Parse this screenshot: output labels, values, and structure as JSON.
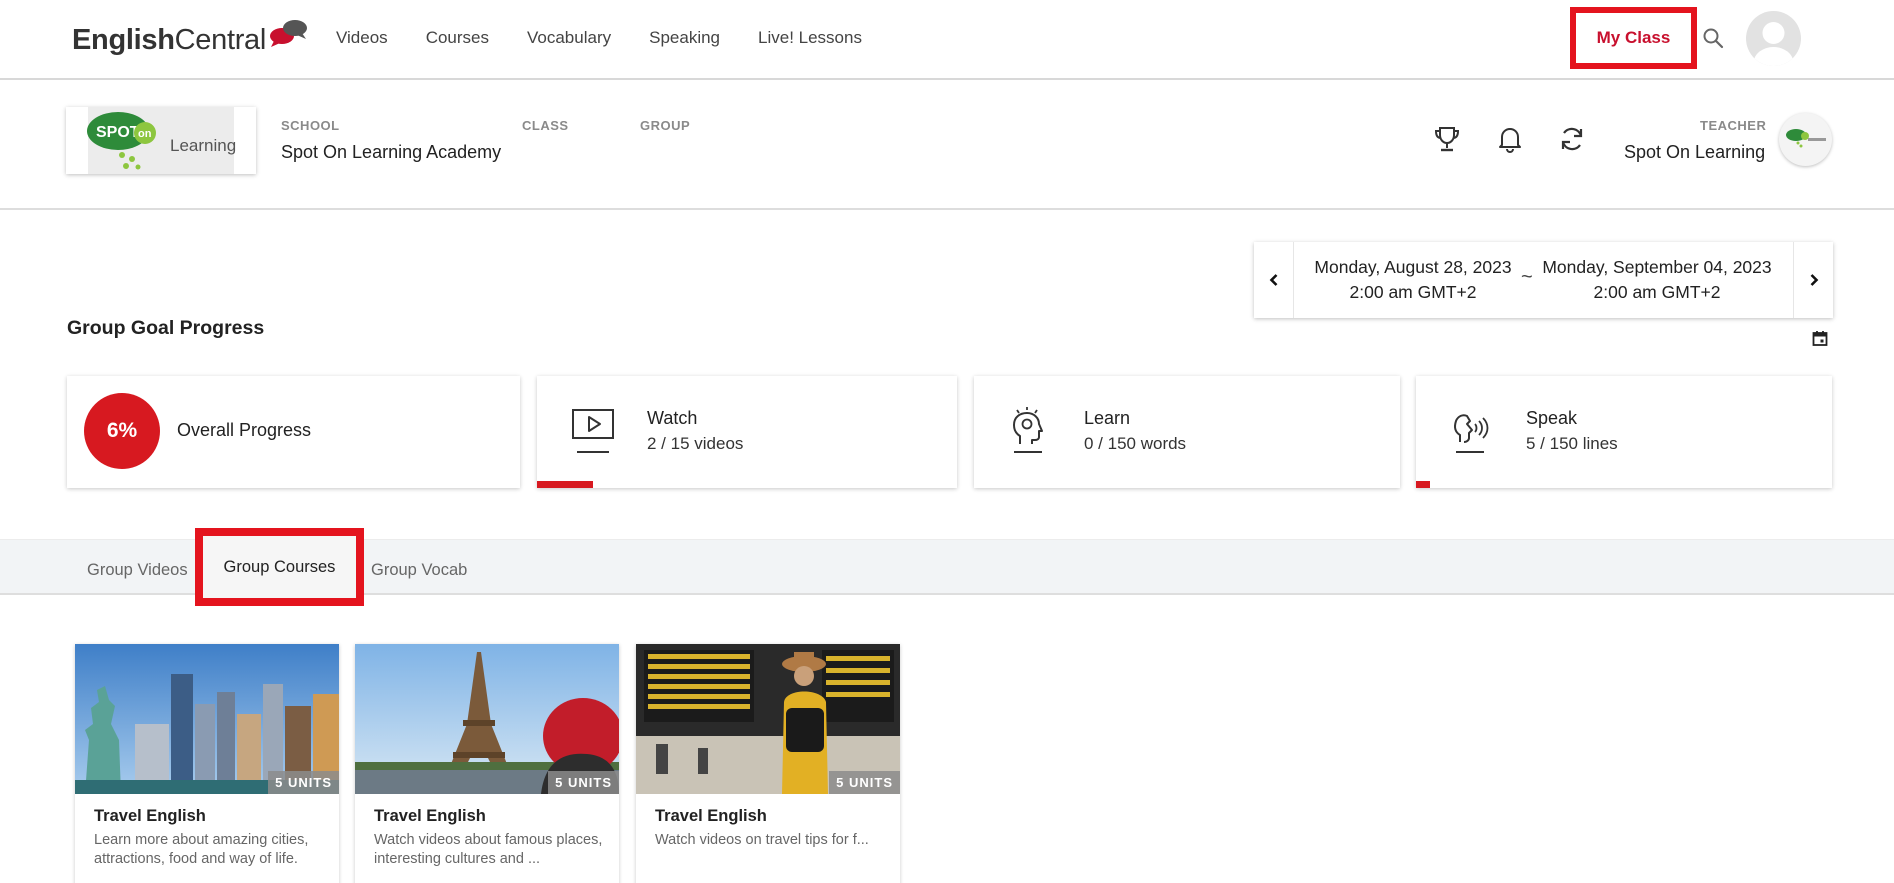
{
  "nav": {
    "logo_bold": "English",
    "logo_light": "Central",
    "links": [
      "Videos",
      "Courses",
      "Vocabulary",
      "Speaking",
      "Live! Lessons"
    ],
    "my_class": "My Class"
  },
  "class_bar": {
    "school_label": "SCHOOL",
    "school_value": "Spot On Learning Academy",
    "class_label": "CLASS",
    "group_label": "GROUP",
    "teacher_label": "TEACHER",
    "teacher_value": "Spot On Learning",
    "logo_spot": "SPOT",
    "logo_on": "on",
    "logo_learning": "Learning"
  },
  "date_range": {
    "start_date": "Monday, August 28, 2023",
    "start_time": "2:00 am GMT+2",
    "separator": "~",
    "end_date": "Monday, September 04, 2023",
    "end_time": "2:00 am GMT+2"
  },
  "goal": {
    "title": "Group Goal Progress",
    "overall_percent": "6%",
    "overall_label": "Overall Progress",
    "watch": {
      "label": "Watch",
      "value": "2 / 15 videos",
      "progress": 0.133
    },
    "learn": {
      "label": "Learn",
      "value": "0 / 150 words",
      "progress": 0.0
    },
    "speak": {
      "label": "Speak",
      "value": "5 / 150 lines",
      "progress": 0.033
    }
  },
  "tabs": {
    "videos": "Group Videos",
    "courses": "Group Courses",
    "vocab": "Group Vocab"
  },
  "courses": [
    {
      "units": "5 UNITS",
      "title": "Travel English",
      "desc": "Learn more about amazing cities, attractions, food and way of life."
    },
    {
      "units": "5 UNITS",
      "title": "Travel English",
      "desc": "Watch videos about famous places, interesting cultures and ..."
    },
    {
      "units": "5 UNITS",
      "title": "Travel English",
      "desc": "Watch videos on travel tips for f..."
    }
  ],
  "colors": {
    "accent": "#d71920",
    "highlight": "#e4141e"
  }
}
